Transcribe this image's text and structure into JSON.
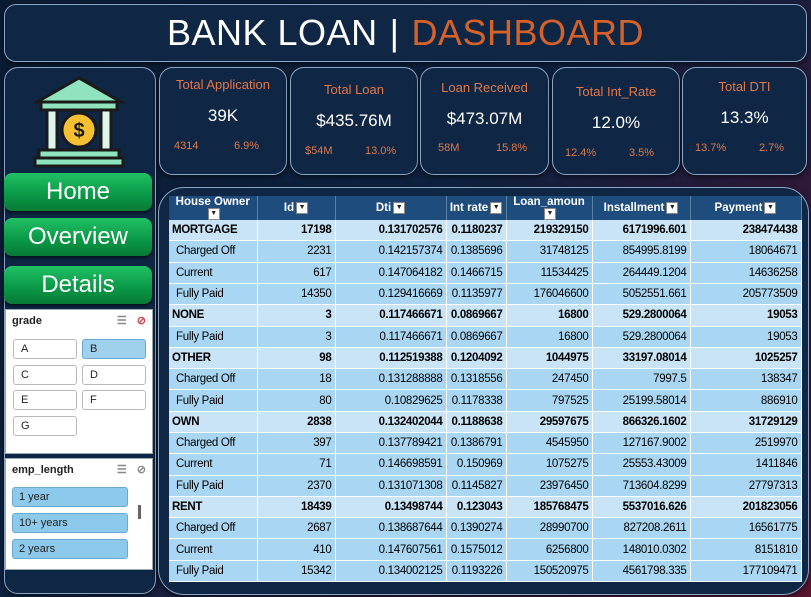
{
  "title": {
    "part1": "BANK LOAN",
    "sep": "|",
    "part2": "DASHBOARD"
  },
  "nav": {
    "home": "Home",
    "overview": "Overview",
    "details": "Details"
  },
  "kpis": [
    {
      "title": "Total Application",
      "value": "39K",
      "sub1": "4314",
      "sub2": "6.9%"
    },
    {
      "title": "Total Loan",
      "value": "$435.76M",
      "sub1": "$54M",
      "sub2": "13.0%"
    },
    {
      "title": "Loan Received",
      "value": "$473.07M",
      "sub1": "58M",
      "sub2": "15.8%"
    },
    {
      "title": "Total Int_Rate",
      "value": "12.0%",
      "sub1": "12.4%",
      "sub2": "3.5%"
    },
    {
      "title": "Total DTI",
      "value": "13.3%",
      "sub1": "13.7%",
      "sub2": "2.7%"
    }
  ],
  "grade_slicer": {
    "title": "grade",
    "items": [
      "A",
      "B",
      "C",
      "D",
      "E",
      "F",
      "G"
    ],
    "selected": "B"
  },
  "emp_slicer": {
    "title": "emp_length",
    "items": [
      "1 year",
      "10+ years",
      "2 years"
    ]
  },
  "table": {
    "headers": [
      "House Owner",
      "Id",
      "Dti",
      "Int rate",
      "Loan_amoun",
      "Installment",
      "Payment"
    ],
    "rows": [
      {
        "type": "grp",
        "cells": [
          "MORTGAGE",
          "17198",
          "0.131702576",
          "0.1180237",
          "219329150",
          "6171996.601",
          "238474438"
        ]
      },
      {
        "type": "sub",
        "cells": [
          "Charged Off",
          "2231",
          "0.142157374",
          "0.1385696",
          "31748125",
          "854995.8199",
          "18064671"
        ]
      },
      {
        "type": "sub",
        "cells": [
          "Current",
          "617",
          "0.147064182",
          "0.1466715",
          "11534425",
          "264449.1204",
          "14636258"
        ]
      },
      {
        "type": "sub",
        "cells": [
          "Fully Paid",
          "14350",
          "0.129416669",
          "0.1135977",
          "176046600",
          "5052551.661",
          "205773509"
        ]
      },
      {
        "type": "grp",
        "cells": [
          "NONE",
          "3",
          "0.117466671",
          "0.0869667",
          "16800",
          "529.2800064",
          "19053"
        ]
      },
      {
        "type": "sub",
        "cells": [
          "Fully Paid",
          "3",
          "0.117466671",
          "0.0869667",
          "16800",
          "529.2800064",
          "19053"
        ]
      },
      {
        "type": "grp",
        "cells": [
          "OTHER",
          "98",
          "0.112519388",
          "0.1204092",
          "1044975",
          "33197.08014",
          "1025257"
        ]
      },
      {
        "type": "sub",
        "cells": [
          "Charged Off",
          "18",
          "0.131288888",
          "0.1318556",
          "247450",
          "7997.5",
          "138347"
        ]
      },
      {
        "type": "sub",
        "cells": [
          "Fully Paid",
          "80",
          "0.10829625",
          "0.1178338",
          "797525",
          "25199.58014",
          "886910"
        ]
      },
      {
        "type": "grp",
        "cells": [
          "OWN",
          "2838",
          "0.132402044",
          "0.1188638",
          "29597675",
          "866326.1602",
          "31729129"
        ]
      },
      {
        "type": "sub",
        "cells": [
          "Charged Off",
          "397",
          "0.137789421",
          "0.1386791",
          "4545950",
          "127167.9002",
          "2519970"
        ]
      },
      {
        "type": "sub",
        "cells": [
          "Current",
          "71",
          "0.146698591",
          "0.150969",
          "1075275",
          "25553.43009",
          "1411846"
        ]
      },
      {
        "type": "sub",
        "cells": [
          "Fully Paid",
          "2370",
          "0.131071308",
          "0.1145827",
          "23976450",
          "713604.8299",
          "27797313"
        ]
      },
      {
        "type": "grp",
        "cells": [
          "RENT",
          "18439",
          "0.13498744",
          "0.123043",
          "185768475",
          "5537016.626",
          "201823056"
        ]
      },
      {
        "type": "sub",
        "cells": [
          "Charged Off",
          "2687",
          "0.138687644",
          "0.1390274",
          "28990700",
          "827208.2611",
          "16561775"
        ]
      },
      {
        "type": "sub",
        "cells": [
          "Current",
          "410",
          "0.147607561",
          "0.1575012",
          "6256800",
          "148010.0302",
          "8151810"
        ]
      },
      {
        "type": "sub",
        "cells": [
          "Fully Paid",
          "15342",
          "0.134002125",
          "0.1193226",
          "150520975",
          "4561798.335",
          "177109471"
        ]
      }
    ]
  }
}
